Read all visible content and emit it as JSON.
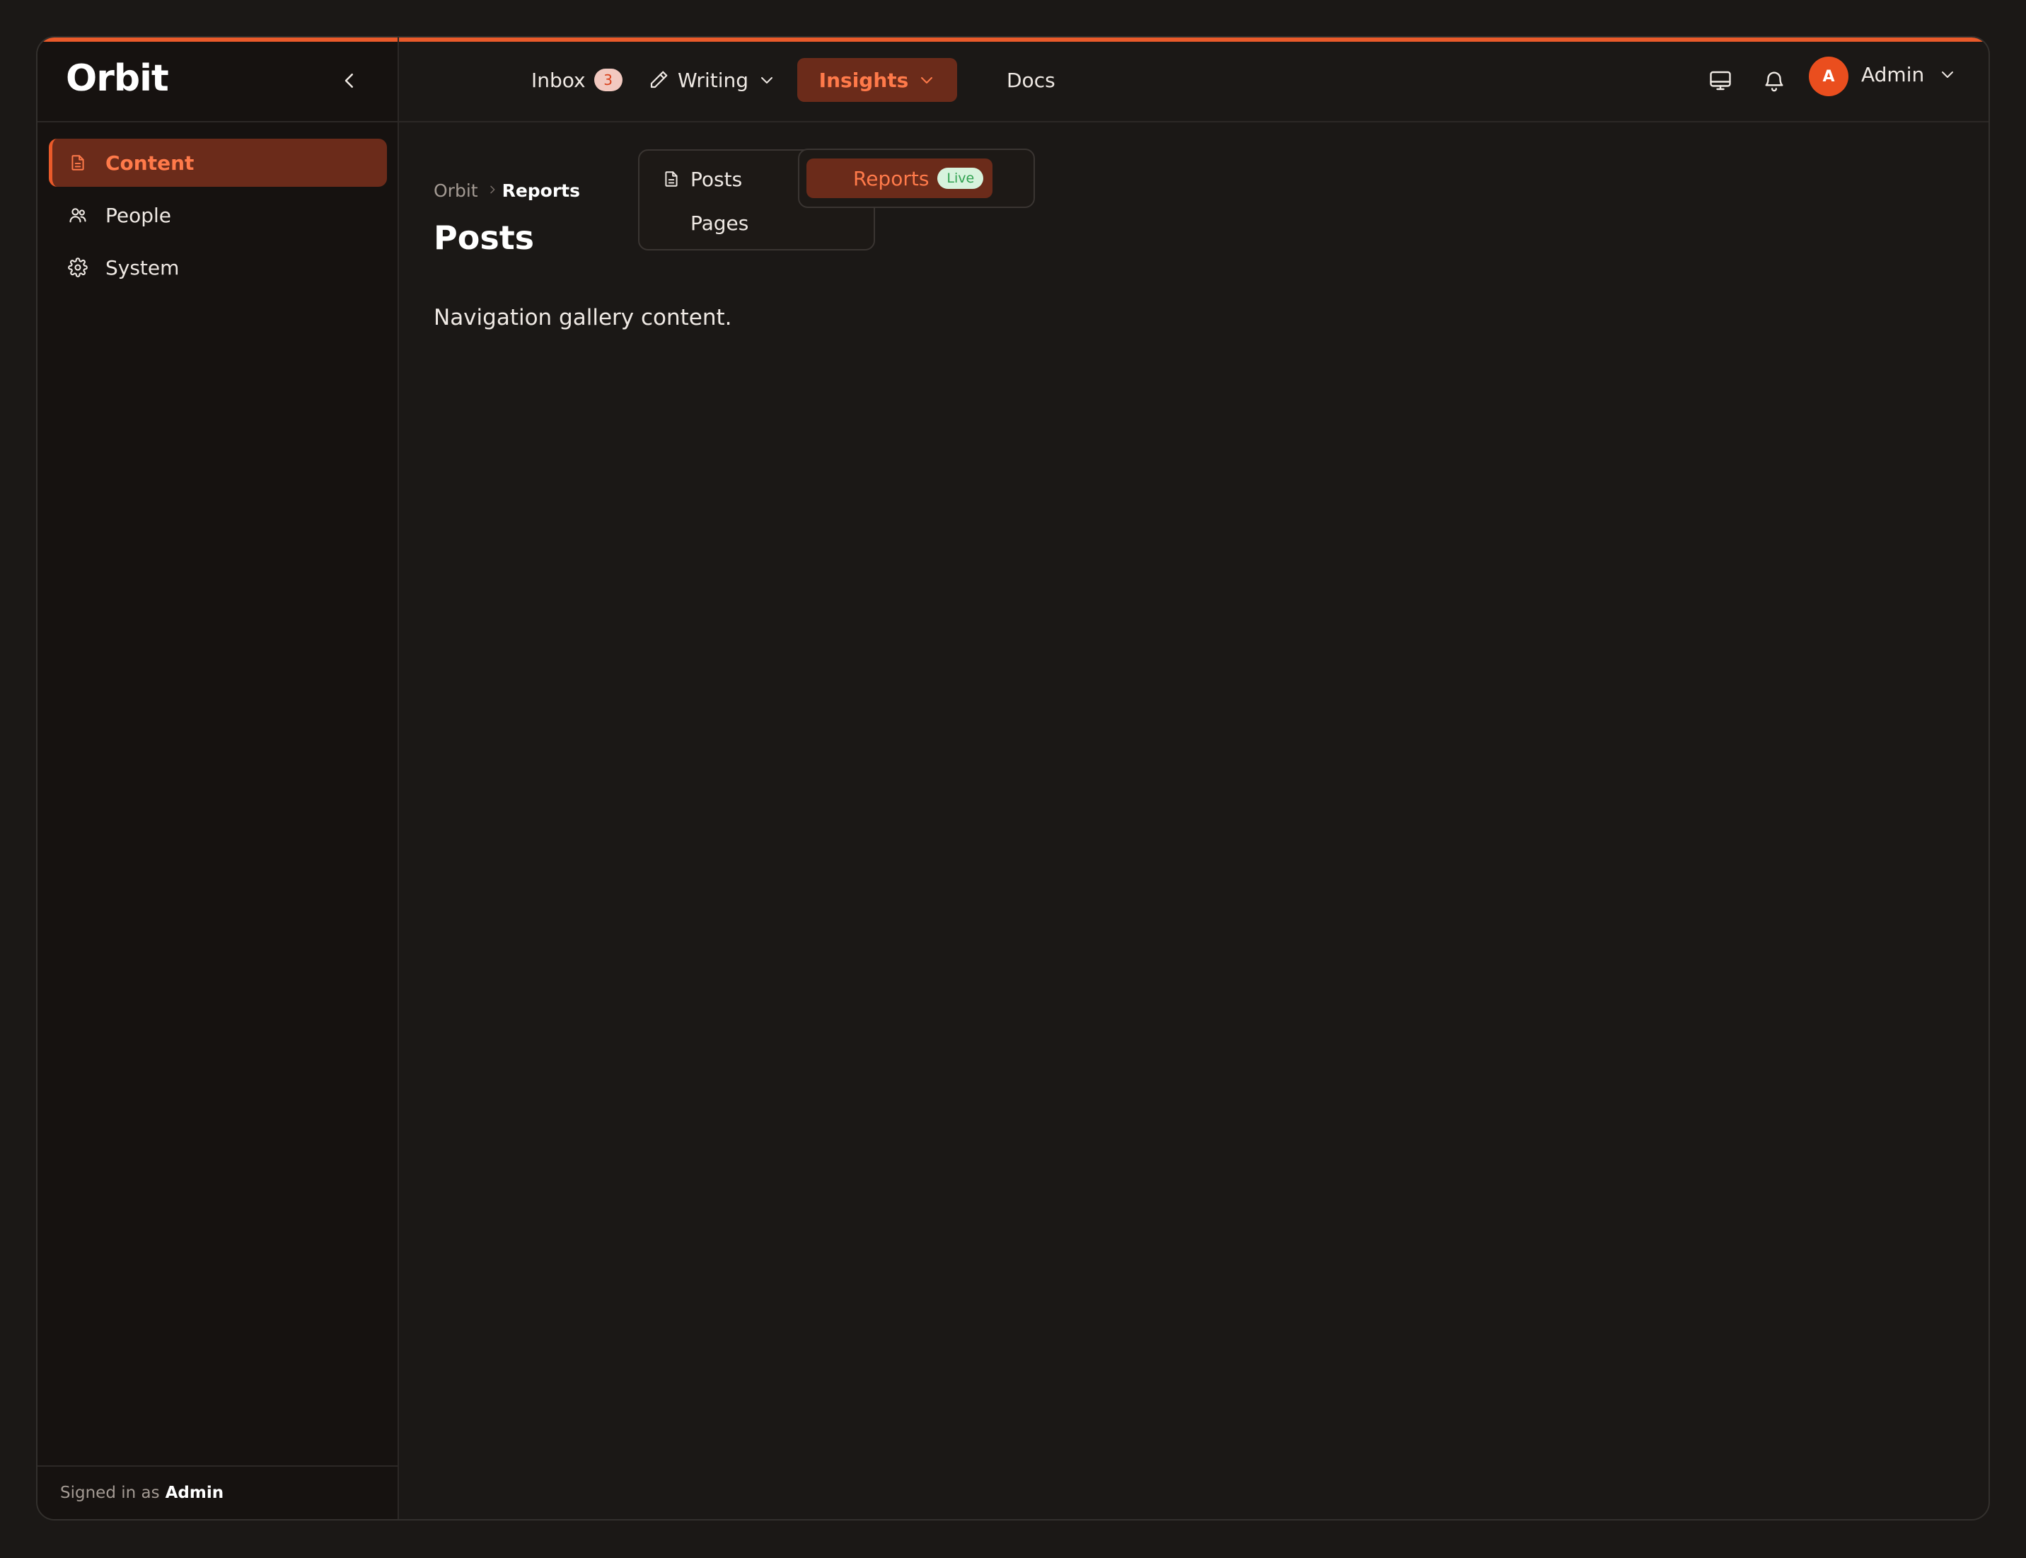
{
  "app": {
    "brand": "Orbit"
  },
  "sidebar": {
    "items": [
      {
        "label": "Content",
        "icon": "document-icon",
        "active": true
      },
      {
        "label": "People",
        "icon": "people-icon",
        "active": false
      },
      {
        "label": "System",
        "icon": "gear-icon",
        "active": false
      }
    ],
    "footer_prefix": "Signed in as",
    "footer_user": "Admin"
  },
  "topnav": {
    "inbox_label": "Inbox",
    "inbox_count": "3",
    "writing_label": "Writing",
    "insights_label": "Insights",
    "docs_label": "Docs",
    "user_avatar_letter": "A",
    "user_name": "Admin"
  },
  "writing_menu": {
    "items": [
      {
        "label": "Posts",
        "icon": "document-icon"
      },
      {
        "label": "Pages"
      }
    ]
  },
  "insights_menu": {
    "items": [
      {
        "label": "Reports",
        "badge": "Live",
        "selected": true
      }
    ]
  },
  "breadcrumb": {
    "root": "Orbit",
    "current": "Reports"
  },
  "page": {
    "title": "Posts",
    "body": "Navigation gallery content."
  },
  "colors": {
    "accent": "#ea5a2a",
    "active_bg": "#6b2b1a",
    "active_text": "#ff7a4a",
    "background": "#1b1816",
    "sidebar_bg": "#161210",
    "live_badge_bg": "#d7f3dd",
    "live_badge_text": "#2fa14f"
  }
}
